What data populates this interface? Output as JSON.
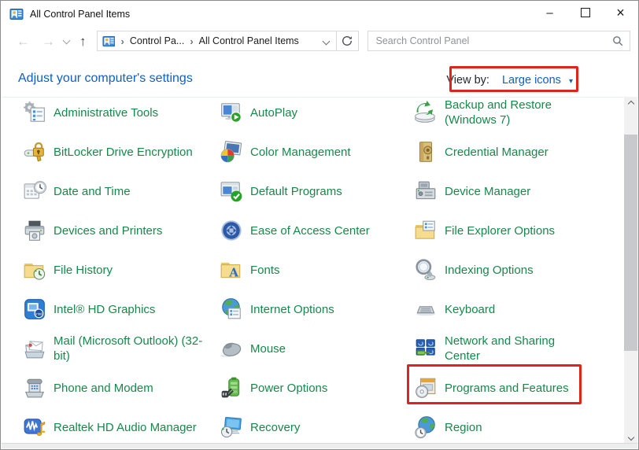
{
  "titlebar": {
    "title": "All Control Panel Items",
    "minimize_glyph": "–",
    "close_glyph": "×"
  },
  "navbar": {
    "back_glyph": "←",
    "forward_glyph": "→",
    "up_glyph": "↑",
    "breadcrumb": {
      "crumbs": [
        "Control Pa...",
        "All Control Panel Items"
      ],
      "separator": "›"
    },
    "search": {
      "placeholder": "Search Control Panel"
    }
  },
  "header": {
    "title": "Adjust your computer's settings",
    "view_by": {
      "label": "View by:",
      "value": "Large icons",
      "dropdown_glyph": "▾"
    }
  },
  "items": [
    {
      "label": "Administrative Tools",
      "icon": "admin-tools"
    },
    {
      "label": "AutoPlay",
      "icon": "autoplay"
    },
    {
      "label": "Backup and Restore (Windows 7)",
      "icon": "backup-restore"
    },
    {
      "label": "BitLocker Drive Encryption",
      "icon": "bitlocker"
    },
    {
      "label": "Color Management",
      "icon": "color-management"
    },
    {
      "label": "Credential Manager",
      "icon": "credential-manager"
    },
    {
      "label": "Date and Time",
      "icon": "date-time"
    },
    {
      "label": "Default Programs",
      "icon": "default-programs"
    },
    {
      "label": "Device Manager",
      "icon": "device-manager"
    },
    {
      "label": "Devices and Printers",
      "icon": "devices-printers"
    },
    {
      "label": "Ease of Access Center",
      "icon": "ease-of-access"
    },
    {
      "label": "File Explorer Options",
      "icon": "file-explorer-options"
    },
    {
      "label": "File History",
      "icon": "file-history"
    },
    {
      "label": "Fonts",
      "icon": "fonts"
    },
    {
      "label": "Indexing Options",
      "icon": "indexing-options"
    },
    {
      "label": "Intel® HD Graphics",
      "icon": "intel-hd-graphics"
    },
    {
      "label": "Internet Options",
      "icon": "internet-options"
    },
    {
      "label": "Keyboard",
      "icon": "keyboard"
    },
    {
      "label": "Mail (Microsoft Outlook) (32-bit)",
      "icon": "mail"
    },
    {
      "label": "Mouse",
      "icon": "mouse"
    },
    {
      "label": "Network and Sharing Center",
      "icon": "network-sharing"
    },
    {
      "label": "Phone and Modem",
      "icon": "phone-modem"
    },
    {
      "label": "Power Options",
      "icon": "power-options"
    },
    {
      "label": "Programs and Features",
      "icon": "programs-features"
    },
    {
      "label": "Realtek HD Audio Manager",
      "icon": "realtek-audio"
    },
    {
      "label": "Recovery",
      "icon": "recovery"
    },
    {
      "label": "Region",
      "icon": "region"
    }
  ],
  "annotations": {
    "highlights": [
      "view-by-selector",
      "programs-and-features-item"
    ]
  },
  "colors": {
    "item_text": "#17884a",
    "link_blue": "#0e5fc6",
    "highlight_red": "#df241c"
  }
}
